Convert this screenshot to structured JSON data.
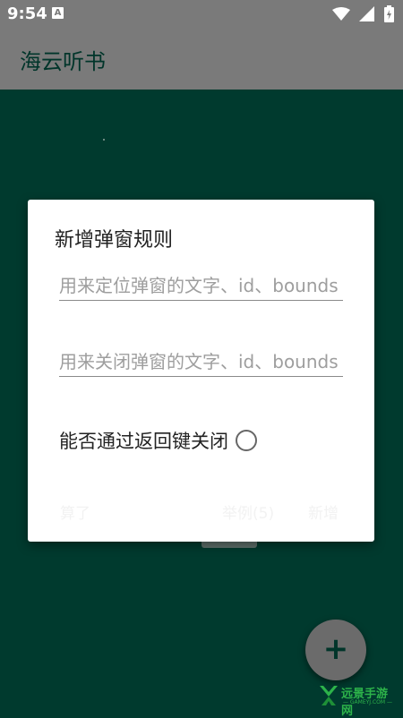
{
  "status_bar": {
    "time": "9:54",
    "notification_badge": "A",
    "icons": [
      "wifi-icon",
      "signal-icon",
      "battery-charging-icon"
    ]
  },
  "app_bar": {
    "title": "海云听书"
  },
  "dialog": {
    "title": "新增弹窗规则",
    "locate_field": {
      "value": "",
      "placeholder": "用来定位弹窗的文字、id、bounds"
    },
    "close_field": {
      "value": "",
      "placeholder": "用来关闭弹窗的文字、id、bounds"
    },
    "back_key_label": "能否通过返回键关闭",
    "back_key_checked": false,
    "buttons": {
      "cancel": "算了",
      "example": "举例(5)",
      "add": "新增"
    }
  },
  "fab": {
    "label": "+"
  },
  "watermark": {
    "text": "远景手游网",
    "sub": "— GAMEYJ.COM —"
  },
  "colors": {
    "background": "#003a2e",
    "app_bar": "#7a7a7a",
    "dialog": "#ffffff",
    "fab": "#6b6b6b",
    "watermark": "#2db34a"
  }
}
